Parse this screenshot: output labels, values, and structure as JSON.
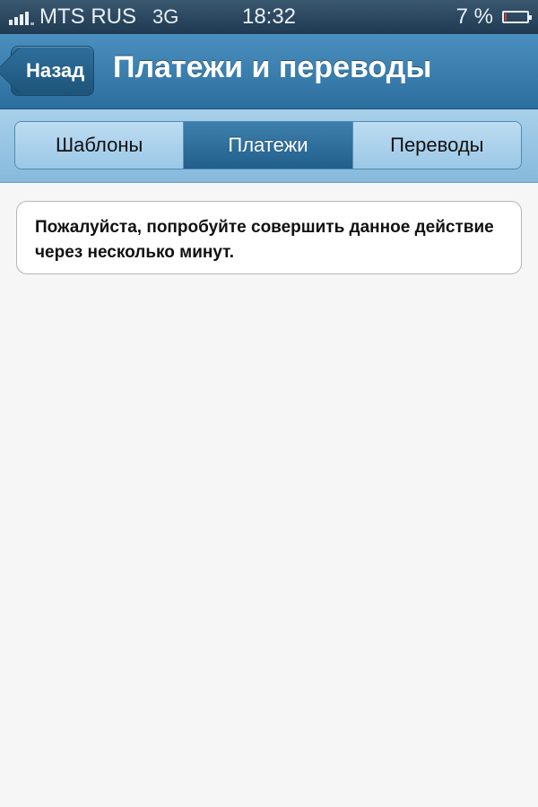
{
  "status_bar": {
    "carrier": "MTS RUS",
    "network": "3G",
    "time": "18:32",
    "battery_percent": "7 %",
    "battery_level": 0.07
  },
  "nav": {
    "back_label": "Назад",
    "title": "Платежи и переводы"
  },
  "segments": [
    {
      "label": "Шаблоны",
      "active": false
    },
    {
      "label": "Платежи",
      "active": true
    },
    {
      "label": "Переводы",
      "active": false
    }
  ],
  "message": {
    "text": "Пожалуйста, попробуйте совершить данное действие через несколько минут."
  },
  "colors": {
    "nav_bar": "#3a80b0",
    "segment_active": "#2d6e9a",
    "battery_low": "#e03030"
  }
}
